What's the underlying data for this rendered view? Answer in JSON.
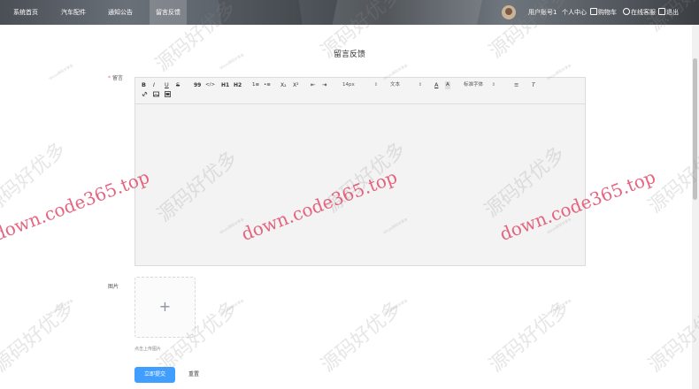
{
  "nav": {
    "items": [
      "系统首页",
      "汽车配件",
      "通知公告",
      "留言反馈"
    ],
    "active_index": 3
  },
  "user": {
    "account": "用户账号1",
    "center": "个人中心",
    "cart": "购物车",
    "service": "在线客服",
    "logout": "退出"
  },
  "page": {
    "title": "留言反馈"
  },
  "form": {
    "message_label": "留言",
    "image_label": "图片",
    "upload_hint": "点击上传图片",
    "submit_label": "立即提交",
    "reset_label": "重置"
  },
  "editor": {
    "toolbar": {
      "bold": "B",
      "italic": "I",
      "underline": "U",
      "strike": "S",
      "quote": "99",
      "code": "</>",
      "h1": "H1",
      "h2": "H2",
      "ordered_list": "1≡",
      "bullet_list": "•≡",
      "subscript": "X₂",
      "superscript": "X²",
      "outdent": "⇤",
      "indent": "⇥",
      "size": "14px",
      "header": "文本",
      "font": "标准字体",
      "color": "A",
      "background": "A",
      "align": "≡",
      "clean": "T"
    },
    "content": ""
  },
  "watermarks": {
    "site": "down.code365.top",
    "brand": "源码好优多",
    "small": "qiuyu源码分享会"
  },
  "colors": {
    "primary": "#409eff",
    "watermark": "#e1506e",
    "required": "#f56c6c"
  }
}
